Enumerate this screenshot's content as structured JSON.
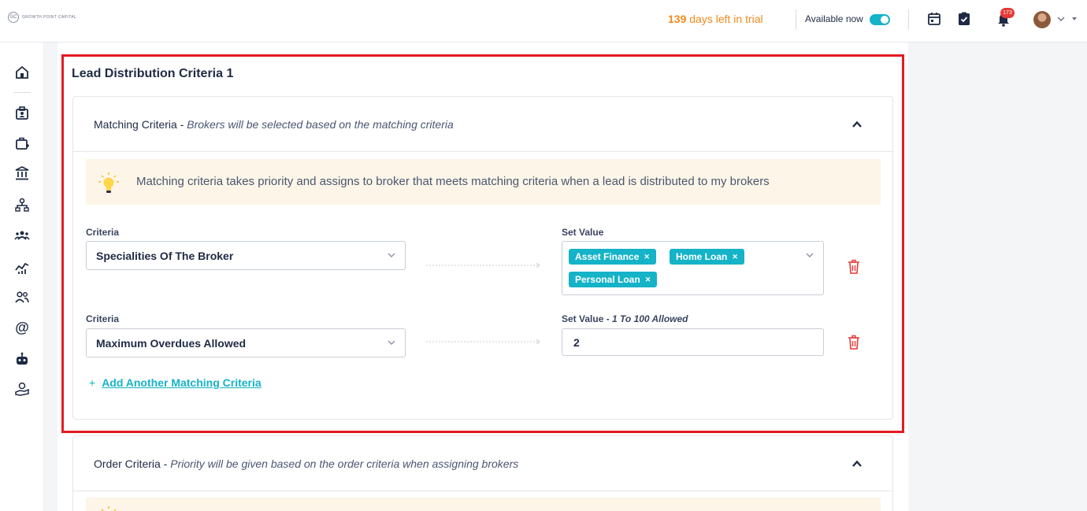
{
  "brand": {
    "logo_mark": "GC",
    "name": "GROWTH POINT CAPITAL"
  },
  "topbar": {
    "trial_days": "139",
    "trial_text": " days left in trial",
    "availability_label": "Available now",
    "notification_count": "173",
    "icons": [
      "calendar-icon",
      "tasks-check-icon",
      "bell-icon",
      "avatar",
      "chevron-down-icon"
    ]
  },
  "sidebar": {
    "icons": [
      "home-icon",
      "broker-badge-icon",
      "briefcase-add-icon",
      "bank-icon",
      "hierarchy-icon",
      "team-icon",
      "analytics-icon",
      "users-icon",
      "at-sign-icon",
      "robot-icon",
      "money-hand-icon"
    ]
  },
  "main": {
    "section_title": "Lead Distribution Criteria 1",
    "matching": {
      "title": "Matching Criteria - ",
      "subtitle": "Brokers will be selected based on the matching criteria",
      "tip": "Matching criteria takes priority and assigns to broker that meets matching criteria when a lead is distributed to my brokers",
      "rows": [
        {
          "criteria_label": "Criteria",
          "criteria_value": "Specialities Of The Broker",
          "value_label": "Set Value",
          "value_hint": "",
          "chips": [
            "Asset Finance",
            "Home Loan",
            "Personal Loan"
          ]
        },
        {
          "criteria_label": "Criteria",
          "criteria_value": "Maximum Overdues Allowed",
          "value_label": "Set Value - ",
          "value_hint": "1 To 100 Allowed",
          "input_value": "2"
        }
      ],
      "add_link": "Add Another Matching Criteria",
      "add_plus": "+"
    },
    "order": {
      "title": "Order Criteria - ",
      "subtitle": "Priority will be given based on the order criteria when assigning brokers"
    }
  },
  "colors": {
    "accent": "#15b3c7",
    "trial": "#f08a1c",
    "highlight": "#e31b23",
    "danger": "#e53935",
    "tip_bg": "#fdf5e7"
  }
}
